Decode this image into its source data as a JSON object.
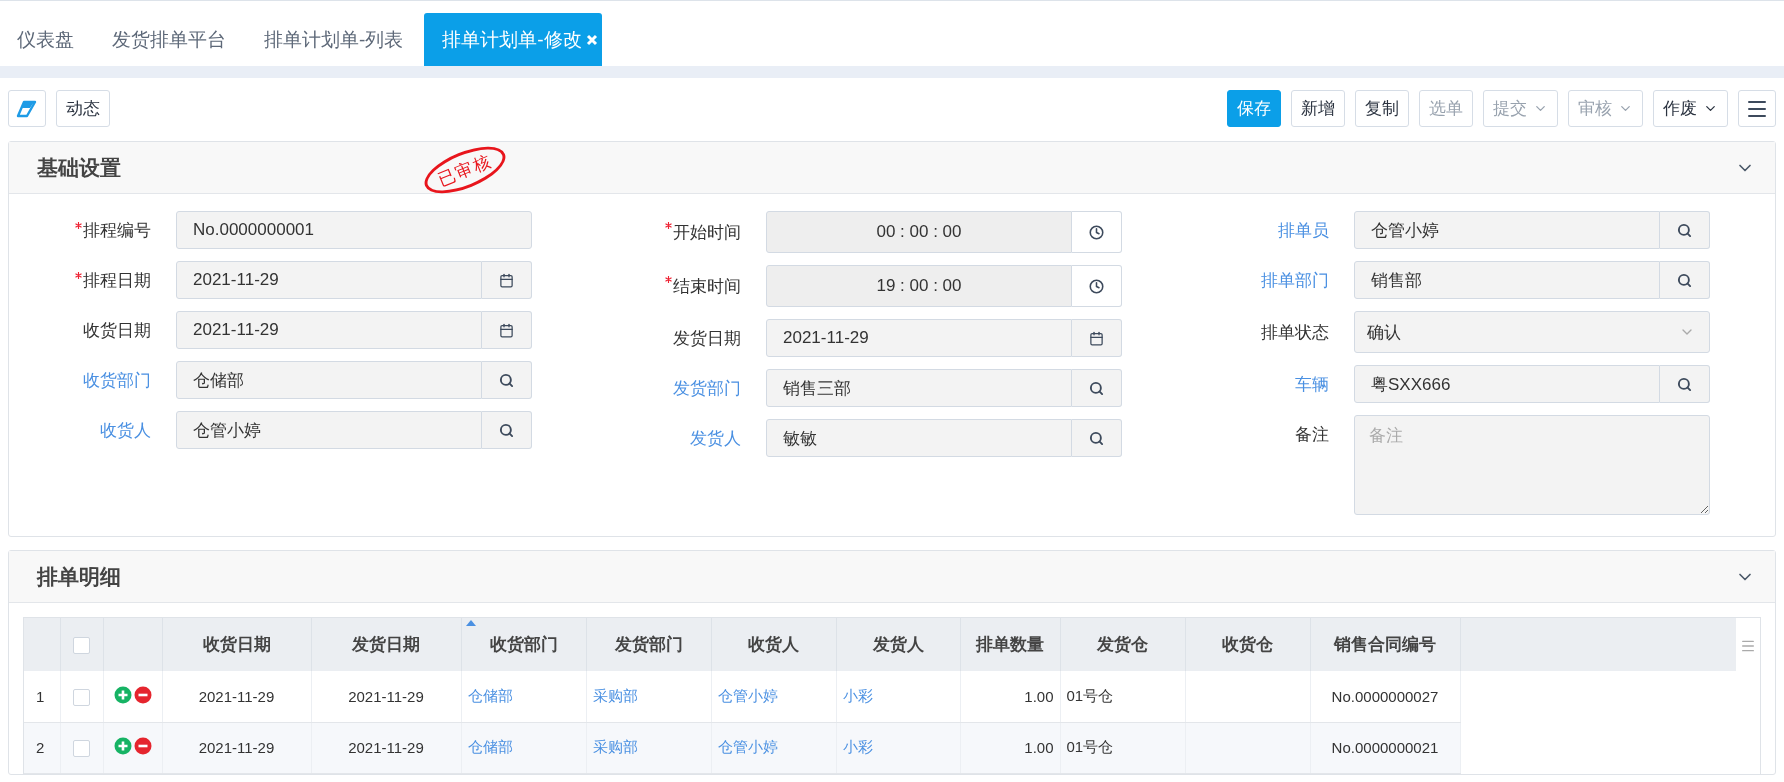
{
  "tabs": [
    {
      "label": "仪表盘",
      "selected": false,
      "closable": false
    },
    {
      "label": "发货排单平台",
      "selected": false,
      "closable": false
    },
    {
      "label": "排单计划单-列表",
      "selected": false,
      "closable": false
    },
    {
      "label": "排单计划单-修改",
      "selected": true,
      "closable": true
    }
  ],
  "toolbar": {
    "left": [
      {
        "kind": "icon"
      },
      {
        "kind": "text",
        "label": "动态"
      }
    ],
    "right": [
      {
        "label": "保存",
        "primary": true,
        "disabled": false,
        "dropdown": false
      },
      {
        "label": "新增",
        "primary": false,
        "disabled": false,
        "dropdown": false
      },
      {
        "label": "复制",
        "primary": false,
        "disabled": false,
        "dropdown": false
      },
      {
        "label": "选单",
        "primary": false,
        "disabled": true,
        "dropdown": false
      },
      {
        "label": "提交",
        "primary": false,
        "disabled": true,
        "dropdown": true
      },
      {
        "label": "审核",
        "primary": false,
        "disabled": true,
        "dropdown": true
      },
      {
        "label": "作废",
        "primary": false,
        "disabled": false,
        "dropdown": true
      }
    ]
  },
  "basic": {
    "title": "基础设置",
    "expanded": true,
    "stamp": "已审核",
    "columns": [
      [
        {
          "label": "排程编号",
          "required": true,
          "link": false,
          "kind": "text",
          "value": "No.0000000001"
        },
        {
          "label": "排程日期",
          "required": true,
          "link": false,
          "kind": "calendar",
          "value": "2021-11-29"
        },
        {
          "label": "收货日期",
          "required": false,
          "link": false,
          "kind": "calendar",
          "value": "2021-11-29"
        },
        {
          "label": "收货部门",
          "required": false,
          "link": true,
          "kind": "search",
          "value": "仓储部"
        },
        {
          "label": "收货人",
          "required": false,
          "link": true,
          "kind": "search",
          "value": "仓管小婷"
        }
      ],
      [
        {
          "label": "开始时间",
          "required": true,
          "link": false,
          "kind": "time",
          "value": "00 : 00 : 00"
        },
        {
          "label": "结束时间",
          "required": true,
          "link": false,
          "kind": "time",
          "value": "19 : 00 : 00"
        },
        {
          "label": "发货日期",
          "required": false,
          "link": false,
          "kind": "calendar",
          "value": "2021-11-29"
        },
        {
          "label": "发货部门",
          "required": false,
          "link": true,
          "kind": "search",
          "value": "销售三部"
        },
        {
          "label": "发货人",
          "required": false,
          "link": true,
          "kind": "search",
          "value": "敏敏"
        }
      ],
      [
        {
          "label": "排单员",
          "required": false,
          "link": true,
          "kind": "search",
          "value": "仓管小婷"
        },
        {
          "label": "排单部门",
          "required": false,
          "link": true,
          "kind": "search",
          "value": "销售部"
        },
        {
          "label": "排单状态",
          "required": false,
          "link": false,
          "kind": "select",
          "value": "确认"
        },
        {
          "label": "车辆",
          "required": false,
          "link": true,
          "kind": "search",
          "value": "粤SXX666"
        },
        {
          "label": "备注",
          "required": false,
          "link": false,
          "kind": "textarea",
          "placeholder": "备注"
        }
      ]
    ]
  },
  "detail": {
    "title": "排单明细",
    "expanded": true,
    "all_checked": false,
    "columns": [
      {
        "label": "收货日期",
        "kind": "date",
        "sorted": false
      },
      {
        "label": "发货日期",
        "kind": "date",
        "sorted": false
      },
      {
        "label": "收货部门",
        "kind": "link",
        "sorted": true
      },
      {
        "label": "发货部门",
        "kind": "link",
        "sorted": false
      },
      {
        "label": "收货人",
        "kind": "link",
        "sorted": false
      },
      {
        "label": "发货人",
        "kind": "link",
        "sorted": false
      },
      {
        "label": "排单数量",
        "kind": "number",
        "sorted": false
      },
      {
        "label": "发货仓",
        "kind": "text",
        "sorted": false
      },
      {
        "label": "收货仓",
        "kind": "text",
        "sorted": false
      },
      {
        "label": "销售合同编号",
        "kind": "code",
        "sorted": false
      }
    ],
    "rows": [
      {
        "index": "1",
        "checked": false,
        "cells": [
          "2021-11-29",
          "2021-11-29",
          "仓储部",
          "采购部",
          "仓管小婷",
          "小彩",
          "1.00",
          "01号仓",
          "",
          "No.0000000027"
        ]
      },
      {
        "index": "2",
        "checked": false,
        "cells": [
          "2021-11-29",
          "2021-11-29",
          "仓储部",
          "采购部",
          "仓管小婷",
          "小彩",
          "1.00",
          "01号仓",
          "",
          "No.0000000021"
        ]
      }
    ]
  }
}
